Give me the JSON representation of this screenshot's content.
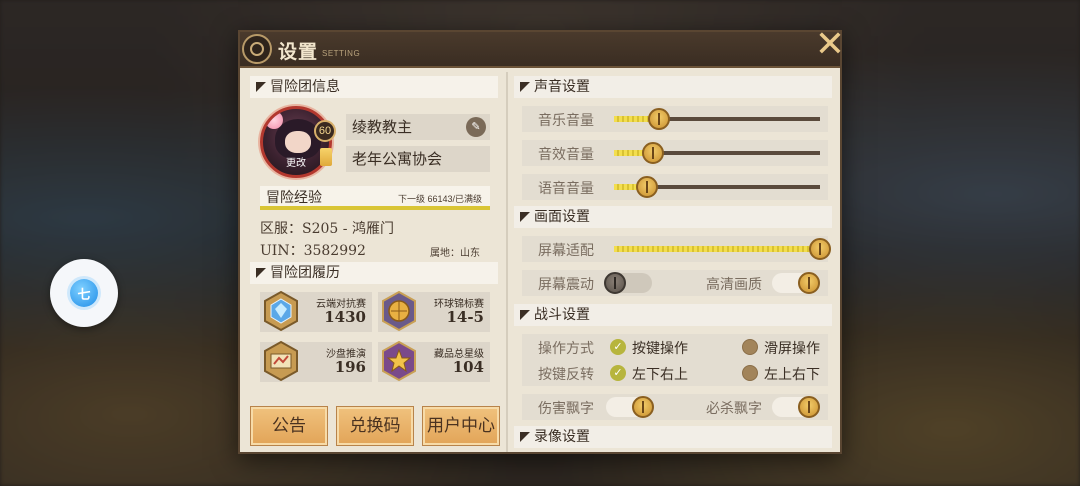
{
  "window": {
    "title": "设置",
    "subtitle": "SETTING"
  },
  "float_button": {
    "label": "七"
  },
  "profile": {
    "section_title": "冒险团信息",
    "level": "60",
    "change_label": "更改",
    "name": "绫教教主",
    "guild": "老年公寓协会",
    "exp_label": "冒险经验",
    "exp_next": "下一级  66143/已满级",
    "exp_progress": 1.0,
    "region": "区服：S205 - 鸿雁门",
    "uin": "UIN：3582992",
    "location": "属地：山东"
  },
  "history": {
    "section_title": "冒险团履历",
    "items": [
      {
        "name": "云端对抗赛",
        "value": "1430",
        "icon": "diamond-rank-icon"
      },
      {
        "name": "环球锦标赛",
        "value": "14-5",
        "icon": "globe-trophy-icon"
      },
      {
        "name": "沙盘推演",
        "value": "196",
        "icon": "sandbox-icon"
      },
      {
        "name": "藏品总星级",
        "value": "104",
        "icon": "collection-star-icon"
      }
    ]
  },
  "buttons": {
    "notice": "公告",
    "redeem": "兑换码",
    "user_center": "用户中心"
  },
  "sound": {
    "section_title": "声音设置",
    "music_label": "音乐音量",
    "music_value": 0.22,
    "sfx_label": "音效音量",
    "sfx_value": 0.19,
    "voice_label": "语音音量",
    "voice_value": 0.16
  },
  "display": {
    "section_title": "画面设置",
    "fit_label": "屏幕适配",
    "fit_value": 1.0,
    "shake_label": "屏幕震动",
    "shake_on": false,
    "hd_label": "高清画质",
    "hd_on": true
  },
  "battle": {
    "section_title": "战斗设置",
    "mode_label": "操作方式",
    "mode_option_1": "按键操作",
    "mode_option_2": "滑屏操作",
    "invert_label": "按键反转",
    "invert_option_1": "左下右上",
    "invert_option_2": "左上右下",
    "damage_label": "伤害飘字",
    "damage_on": true,
    "crit_label": "必杀飘字",
    "crit_on": true
  },
  "record": {
    "section_title": "录像设置"
  },
  "colors": {
    "accent_gold": "#e2a458",
    "slider_fill": "#f3de4e",
    "panel_bg": "#ece5d6",
    "title_bar": "#3a2d22"
  }
}
